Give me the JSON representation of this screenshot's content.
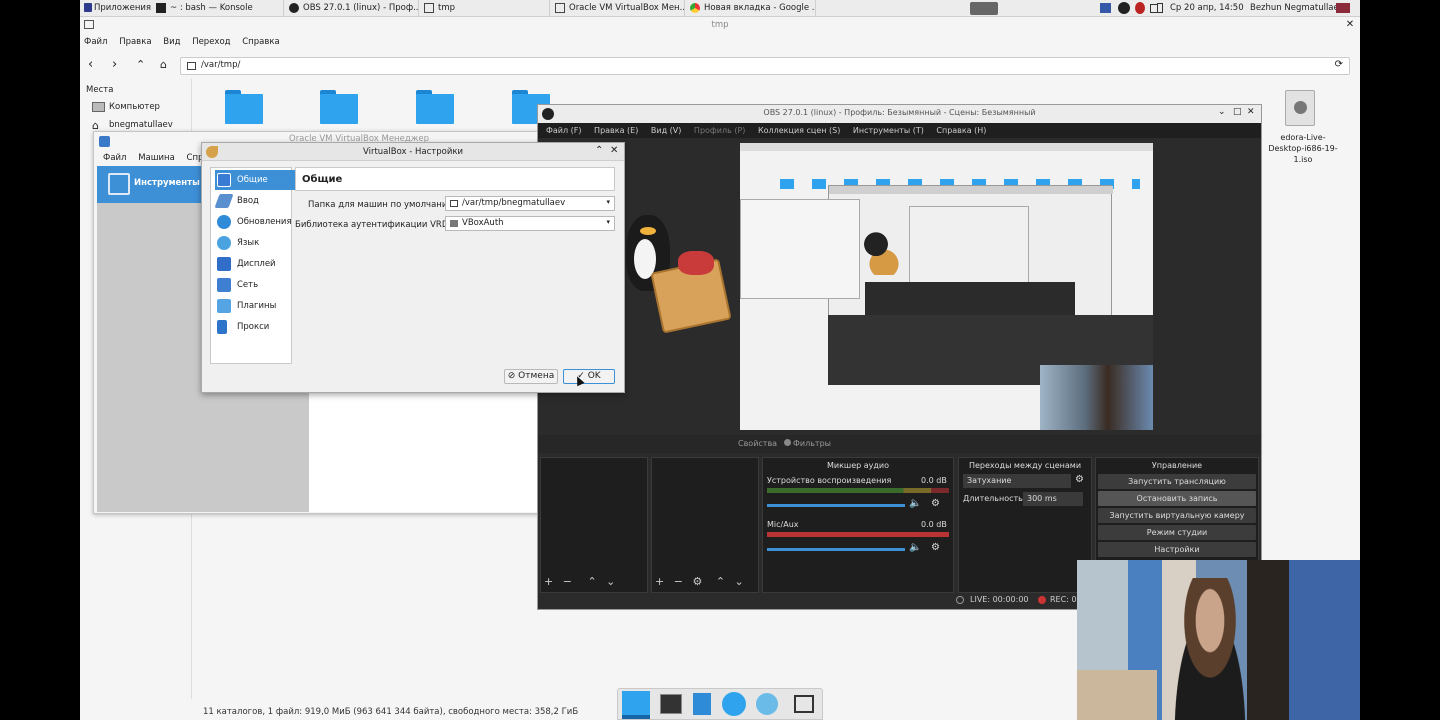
{
  "taskbar": {
    "apps_label": "Приложения",
    "tabs": [
      {
        "label": "~ : bash — Konsole"
      },
      {
        "label": "OBS 27.0.1 (linux) - Проф..."
      },
      {
        "label": "tmp"
      },
      {
        "label": "Oracle VM VirtualBox Мен..."
      },
      {
        "label": "Новая вкладка - Google ..."
      }
    ],
    "clock": "Ср 20 апр, 14:50",
    "user": "Bezhun Negmatullaev"
  },
  "filemanager": {
    "title": "tmp",
    "menu": [
      "Файл",
      "Правка",
      "Вид",
      "Переход",
      "Справка"
    ],
    "path": "/var/tmp/",
    "places_header": "Места",
    "places": [
      "Компьютер",
      "bnegmatullaev"
    ],
    "iso_name": "edora-Live-Desktop-i686-19-1.iso",
    "status": "11 каталогов, 1 файл: 919,0 МиБ (963 641 344 байта), свободного места: 358,2 ГиБ"
  },
  "vbox_manager": {
    "title": "Oracle VM VirtualBox Менеджер",
    "menu": [
      "Файл",
      "Машина",
      "Справ"
    ],
    "tools_label": "Инструменты"
  },
  "vbox_settings": {
    "title": "VirtualBox - Настройки",
    "section_title": "Общие",
    "nav": [
      {
        "label": "Общие",
        "color": "#3a7bd5"
      },
      {
        "label": "Ввод",
        "color": "#5a8fd0"
      },
      {
        "label": "Обновления",
        "color": "#2e8bd8"
      },
      {
        "label": "Язык",
        "color": "#4aa3e0"
      },
      {
        "label": "Дисплей",
        "color": "#2f6fc9"
      },
      {
        "label": "Сеть",
        "color": "#3f7fd2"
      },
      {
        "label": "Плагины",
        "color": "#55a5e5"
      },
      {
        "label": "Прокси",
        "color": "#2e74c8"
      }
    ],
    "folder_label": "Папка для машин по умолчанию:",
    "folder_value": "/var/tmp/bnegmatullaev",
    "vrdp_label": "Библиотека аутентификации VRDP:",
    "vrdp_value": "VBoxAuth",
    "cancel": "Отмена",
    "ok": "OK"
  },
  "obs": {
    "title": "OBS 27.0.1 (linux) - Профиль: Безымянный - Сцены: Безымянный",
    "menu": [
      "Файл (F)",
      "Правка (E)",
      "Вид (V)",
      "Профиль (P)",
      "Коллекция сцен (S)",
      "Инструменты (T)",
      "Справка (H)"
    ],
    "tabs": [
      "Свойства",
      "Фильтры"
    ],
    "mixer_title": "Микшер аудио",
    "channels": [
      {
        "name": "Устройство воспроизведения",
        "db": "0.0 dB"
      },
      {
        "name": "Mic/Aux",
        "db": "0.0 dB"
      }
    ],
    "transitions_title": "Переходы между сценами",
    "transition": "Затухание",
    "duration_label": "Длительность",
    "duration_value": "300 ms",
    "controls_title": "Управление",
    "controls": [
      "Запустить трансляцию",
      "Остановить запись",
      "Запустить виртуальную камеру",
      "Режим студии",
      "Настройки"
    ],
    "live": "LIVE: 00:00:00",
    "rec": "REC: 0"
  },
  "colors": {
    "accent": "#3d8fd6",
    "obs_bg": "#2b2b2b",
    "folder": "#2fa3ee",
    "meter_green": "#5fbf3a",
    "meter_red": "#d43b3b"
  }
}
